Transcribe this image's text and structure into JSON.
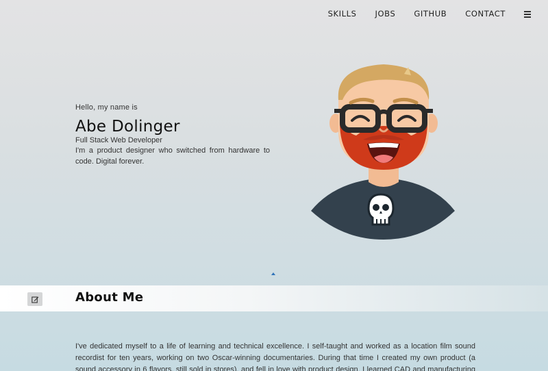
{
  "nav": {
    "links": [
      "SKILLS",
      "JOBS",
      "GITHUB",
      "CONTACT"
    ],
    "menu_icon": "hamburger-menu-icon"
  },
  "hero": {
    "greeting": "Hello, my name is",
    "name": "Abe Dolinger",
    "role": "Full Stack Web Developer",
    "bio": "I'm a product designer who switched from hardware to code. Digital forever."
  },
  "avatar": {
    "icon": "cartoon-avatar-bearded-man-with-glasses",
    "shirt_icon": "skull-icon",
    "colors": {
      "hair": "#d4a862",
      "beard": "#cf3a1a",
      "skin": "#f7c9a4",
      "shirt": "#33414d",
      "glasses": "#2a2a2a"
    }
  },
  "scroll_up_icon": "caret-up-icon",
  "about": {
    "title": "About Me",
    "edit_icon": "edit-icon",
    "text": "I've dedicated myself to a life of learning and technical excellence. I self-taught and worked as a location film sound recordist for ten years, working on two Oscar-winning documentaries. During that time I created my own product (a sound accessory in 6 flavors, still sold in stores), and fell in love with product design. I learned CAD and manufacturing on the job, and coded"
  },
  "colors": {
    "accent": "#2f73b9",
    "text": "#1f1f1f"
  }
}
